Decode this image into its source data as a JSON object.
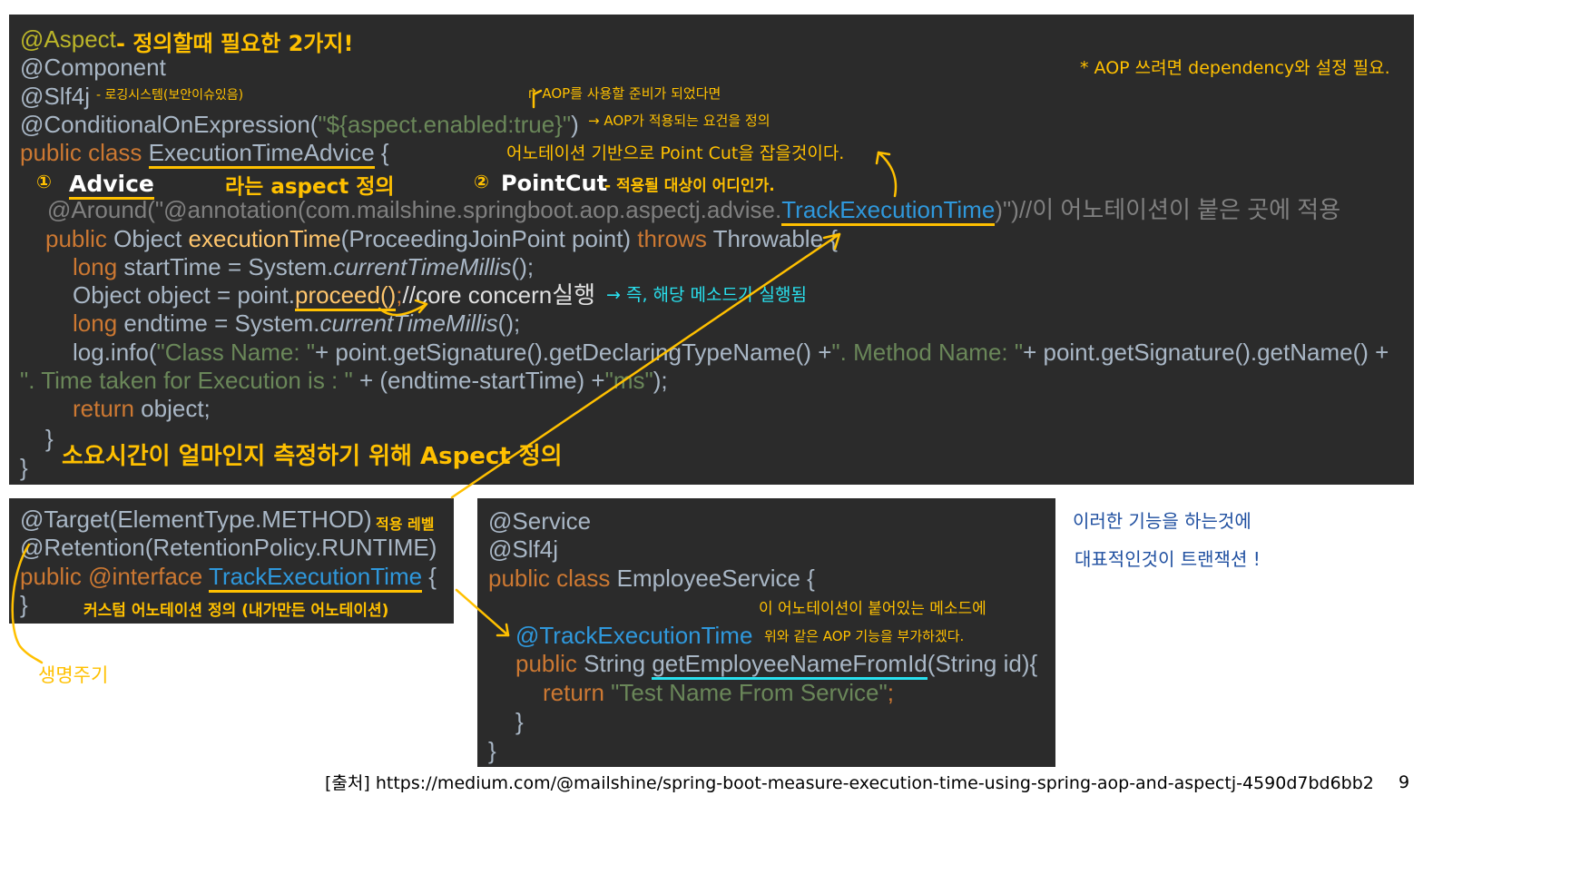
{
  "aspect_panel": {
    "l1": "@Aspect",
    "l2": "@Component",
    "l3": "@Slf4j",
    "l4a": "@ConditionalOnExpression(",
    "l4b": "\"${aspect.enabled:true}\"",
    "l4c": ")",
    "l5a": "public class ",
    "l5b": "ExecutionTimeAdvice",
    "l5c": " {",
    "l7a": "@Around(\"@annotation(com.mailshine.springboot.aop.aspectj.advise.",
    "l7b": "TrackExecutionTime",
    "l7c": ")\")//이 어노테이션이 붙은 곳에 적용",
    "l8a": "public ",
    "l8b": "Object ",
    "l8c": "executionTime",
    "l8d": "(ProceedingJoinPoint point) ",
    "l8e": "throws ",
    "l8f": "Throwable {",
    "l9a": "long ",
    "l9b": "startTime = System.",
    "l9c": "currentTimeMillis",
    "l9d": "();",
    "l10a": "Object object = point.",
    "l10b": "proceed()",
    "l10c": ";",
    "l10d": "//core concern실행",
    "l11a": "long ",
    "l11b": "endtime = System.",
    "l11c": "currentTimeMillis",
    "l11d": "();",
    "l12a": "log.info(",
    "l12b": "\"Class Name: \"",
    "l12c": "+ point.getSignature().getDeclaringTypeName() +",
    "l12d": "\". Method Name: \"",
    "l12e": "+ point.getSignature().getName() +",
    "l13a": "\". Time taken for Execution is : \"",
    "l13b": " + (endtime-startTime) +",
    "l13c": "\"ms\"",
    "l13d": ");",
    "l14a": "return ",
    "l14b": "object;",
    "l15": "}",
    "l16": "}"
  },
  "annotation_panel": {
    "l1": "@Target(ElementType.METHOD)",
    "l2": "@Retention(RetentionPolicy.RUNTIME)",
    "l3a": "public ",
    "l3b": "@interface ",
    "l3c": "TrackExecutionTime",
    "l3d": " {",
    "l4": "}"
  },
  "service_panel": {
    "l1": "@Service",
    "l2": "@Slf4j",
    "l3a": "public class ",
    "l3b": "EmployeeService {",
    "l4": "@TrackExecutionTime",
    "l5a": "public ",
    "l5b": "String ",
    "l5c": "getEmployeeNameFromId",
    "l5d": "(String id){",
    "l6a": "return ",
    "l6b": "\"Test Name From Service\"",
    "l6c": ";",
    "l7": "}",
    "l8": "}"
  },
  "handwritten": {
    "aspect_note": "- 정의할때 필요한 2가지!",
    "slf4j_note": "- 로깅시스템(보안이슈있음)",
    "aop_ready": "↱ AOP를 사용할 준비가 되었다면",
    "aop_condition": "→ AOP가 적용되는 요건을 정의",
    "aop_dependency": "* AOP 쓰려면  dependency와 설정 필요.",
    "pointcut_top": "어노테이션 기반으로 Point Cut을 잡을것이다.",
    "advice_num": "①",
    "advice_label": "Advice",
    "advice_desc": "라는  aspect 정의",
    "pointcut_num": "②",
    "pointcut_label": "PointCut",
    "pointcut_desc": "- 적용될 대상이 어디인가.",
    "proceed_note": "→ 즉, 해당 메소드가  실행됨",
    "aspect_summary": "소요시간이 얼마인지 측정하기 위해  Aspect  정의",
    "target_note": "적용 레벨",
    "custom_note": "커스텀 어노테이션 정의 (내가만든 어노테이션)",
    "lifecycle": "생명주기",
    "service_note1": "이 어노테이션이 붙어있는 메소드에",
    "service_note2": "위와 같은  AOP 기능을 부가하겠다.",
    "transaction1": "이러한 기능을 하는것에",
    "transaction2": "대표적인것이  트랜잭션 !"
  },
  "footer": {
    "source_label": "[출처] ",
    "source_url": "https://medium.com/@mailshine/spring-boot-measure-execution-time-using-spring-aop-and-aspectj-4590d7bd6bb2",
    "page_number": "9"
  }
}
